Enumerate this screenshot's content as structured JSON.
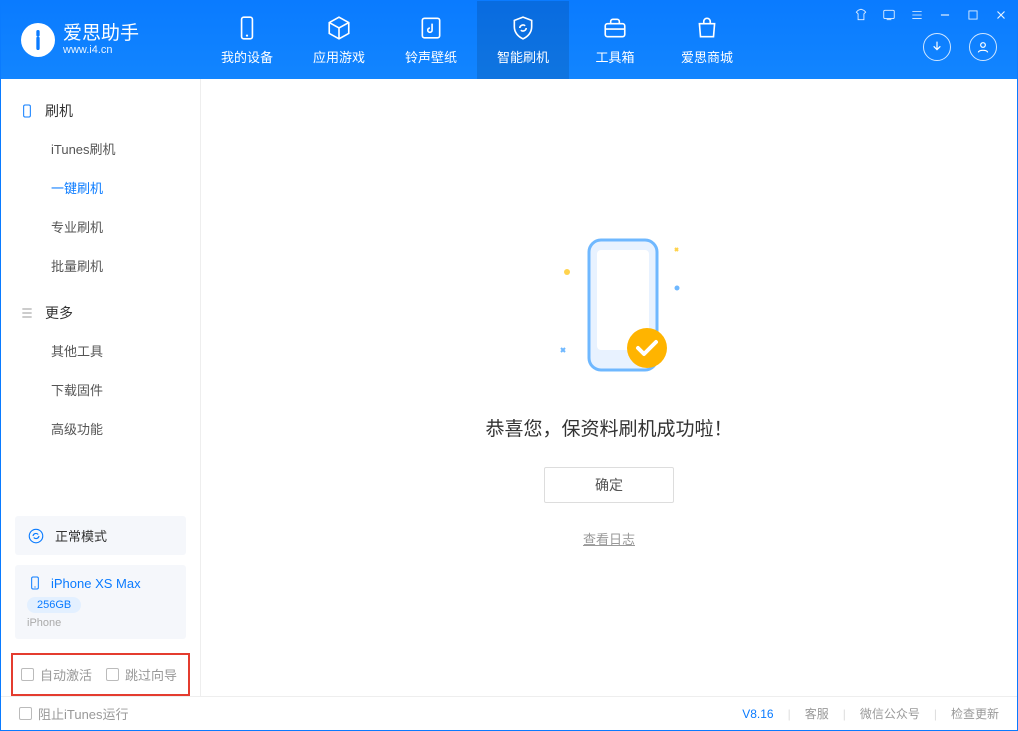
{
  "app": {
    "name_cn": "爱思助手",
    "name_en": "www.i4.cn"
  },
  "nav": {
    "items": [
      {
        "label": "我的设备"
      },
      {
        "label": "应用游戏"
      },
      {
        "label": "铃声壁纸"
      },
      {
        "label": "智能刷机"
      },
      {
        "label": "工具箱"
      },
      {
        "label": "爱思商城"
      }
    ]
  },
  "sidebar": {
    "section1_title": "刷机",
    "section1_items": [
      {
        "label": "iTunes刷机"
      },
      {
        "label": "一键刷机"
      },
      {
        "label": "专业刷机"
      },
      {
        "label": "批量刷机"
      }
    ],
    "section2_title": "更多",
    "section2_items": [
      {
        "label": "其他工具"
      },
      {
        "label": "下载固件"
      },
      {
        "label": "高级功能"
      }
    ],
    "mode_label": "正常模式",
    "device": {
      "name": "iPhone XS Max",
      "capacity": "256GB",
      "type": "iPhone"
    },
    "checkbox_auto_activate": "自动激活",
    "checkbox_skip_guide": "跳过向导"
  },
  "main": {
    "success_msg": "恭喜您，保资料刷机成功啦！",
    "ok_button": "确定",
    "view_log": "查看日志"
  },
  "footer": {
    "block_itunes": "阻止iTunes运行",
    "version": "V8.16",
    "support": "客服",
    "wechat": "微信公众号",
    "check_update": "检查更新"
  }
}
